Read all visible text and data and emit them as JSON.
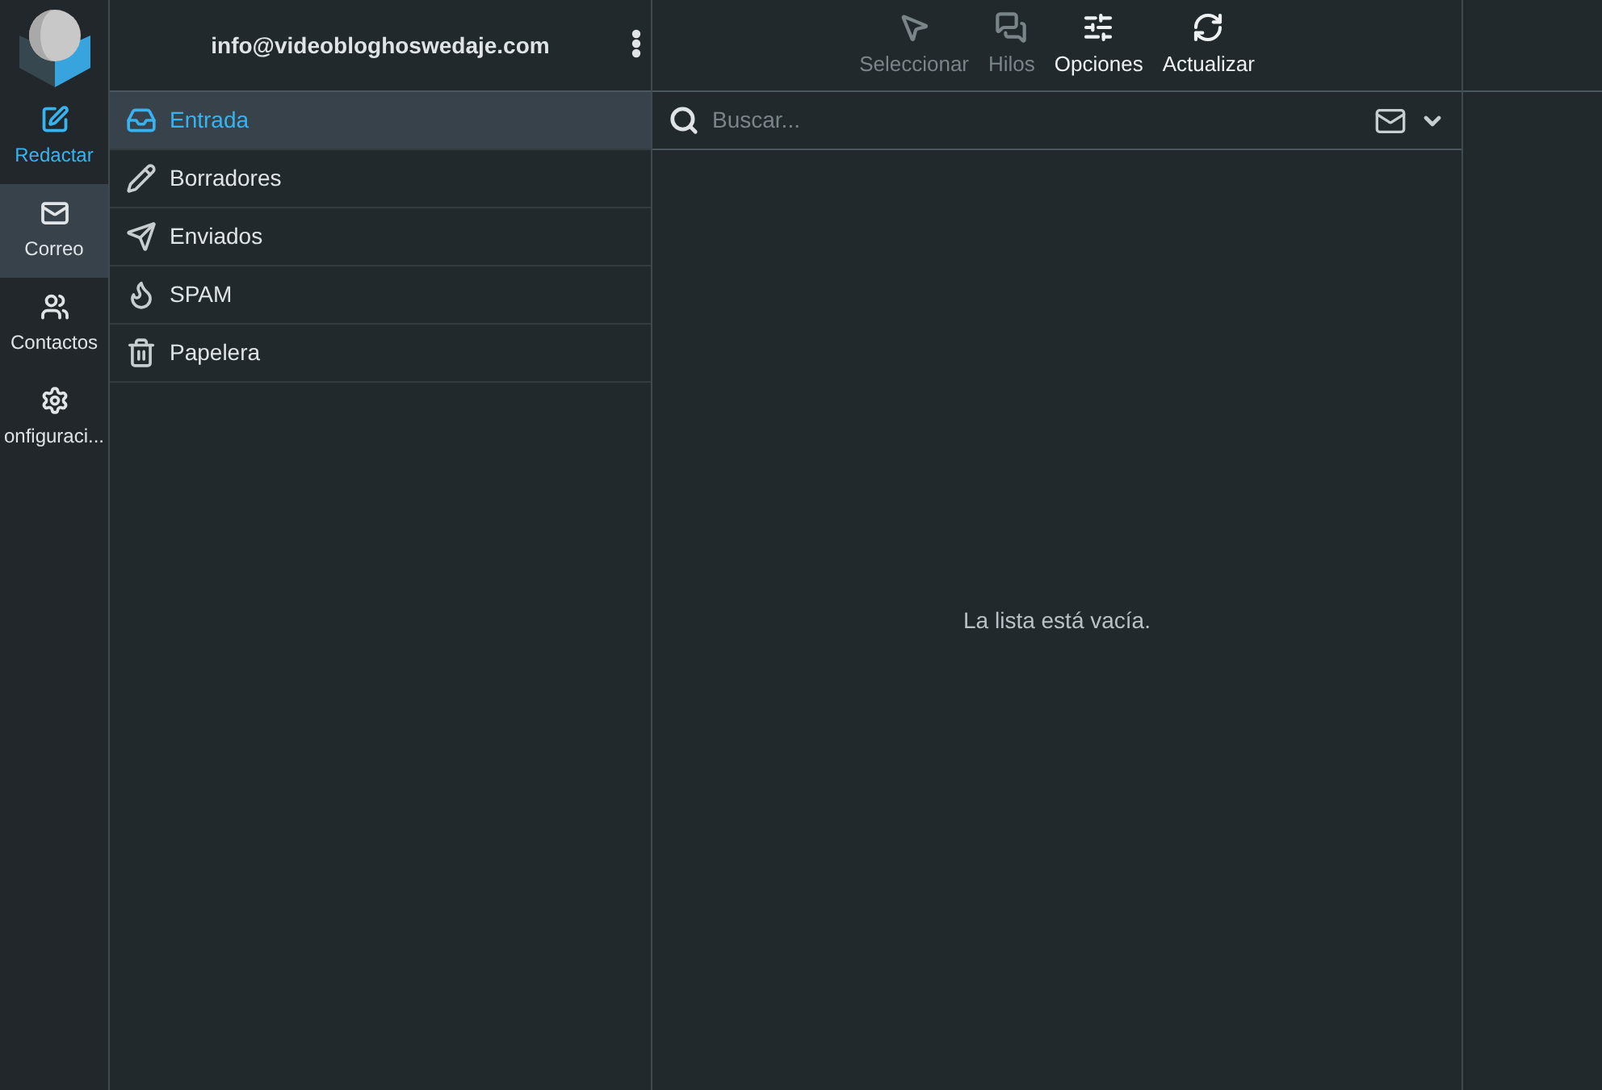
{
  "rail": [
    {
      "kind": "compose",
      "label": "Redactar",
      "selected": false
    },
    {
      "kind": "mail",
      "label": "Correo",
      "selected": true
    },
    {
      "kind": "contacts",
      "label": "Contactos",
      "selected": false
    },
    {
      "kind": "settings",
      "label": "onfiguraci..."
    }
  ],
  "account": {
    "email": "info@videobloghoswedaje.com"
  },
  "folders": [
    {
      "kind": "inbox",
      "label": "Entrada",
      "selected": true
    },
    {
      "kind": "drafts",
      "label": "Borradores",
      "selected": false
    },
    {
      "kind": "sent",
      "label": "Enviados",
      "selected": false
    },
    {
      "kind": "spam",
      "label": "SPAM",
      "selected": false
    },
    {
      "kind": "trash",
      "label": "Papelera",
      "selected": false
    }
  ],
  "toolbar": [
    {
      "kind": "select",
      "label": "Seleccionar",
      "disabled": true
    },
    {
      "kind": "threads",
      "label": "Hilos",
      "disabled": true
    },
    {
      "kind": "options",
      "label": "Opciones",
      "disabled": false
    },
    {
      "kind": "refresh",
      "label": "Actualizar",
      "disabled": false
    }
  ],
  "search": {
    "placeholder": "Buscar..."
  },
  "empty_message": "La lista está vacía."
}
